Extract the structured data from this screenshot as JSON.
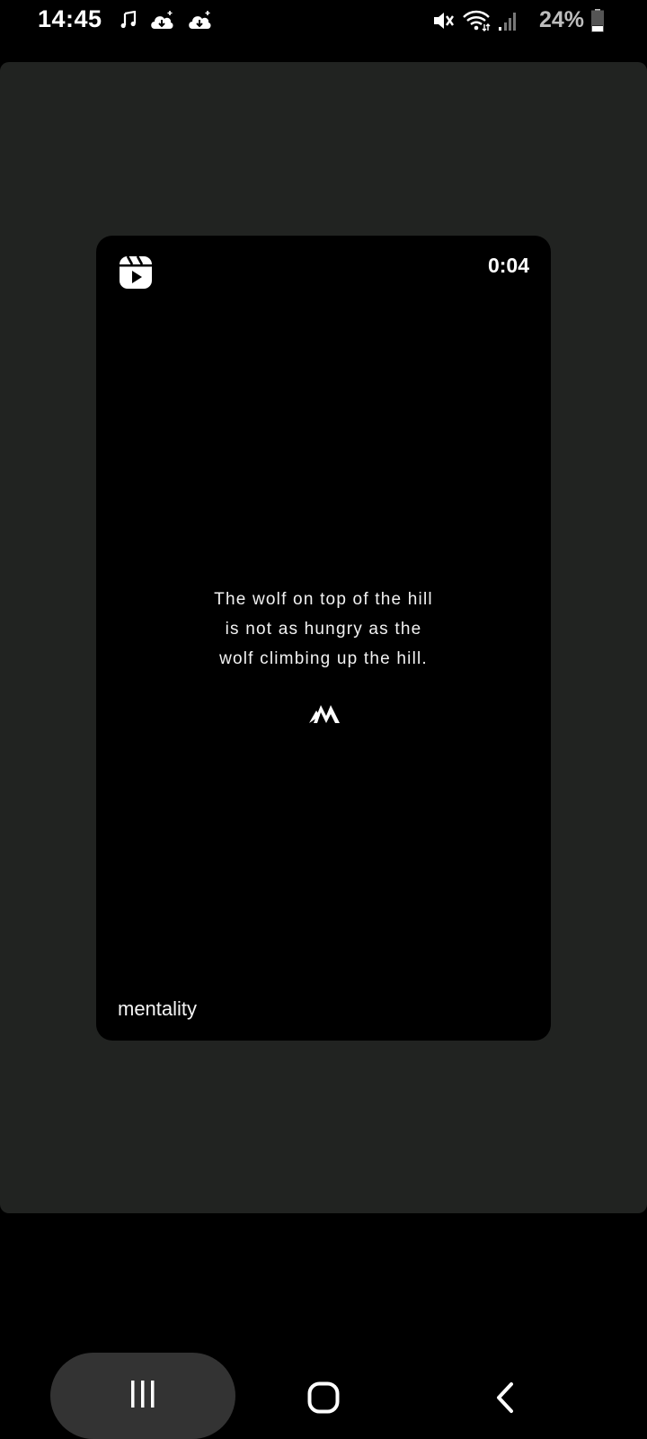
{
  "status_bar": {
    "time": "14:45",
    "left_icons": [
      "music-note-icon",
      "cloud-download-icon",
      "cloud-download-icon"
    ],
    "right_icons": [
      "vibrate-mute-icon",
      "wifi-icon",
      "signal-icon"
    ],
    "battery": "24%"
  },
  "reel": {
    "duration": "0:04",
    "quote_lines": [
      "The wolf on top of the hill",
      "is not as hungry as the",
      "wolf climbing up the hill."
    ],
    "author": "mentality"
  },
  "nav": {
    "recents_icon": "recents-icon",
    "home_icon": "home-icon",
    "back_icon": "back-icon"
  },
  "colors": {
    "panel_bg": "#212321",
    "card_bg": "#000000",
    "nav_pill": "#333333"
  }
}
